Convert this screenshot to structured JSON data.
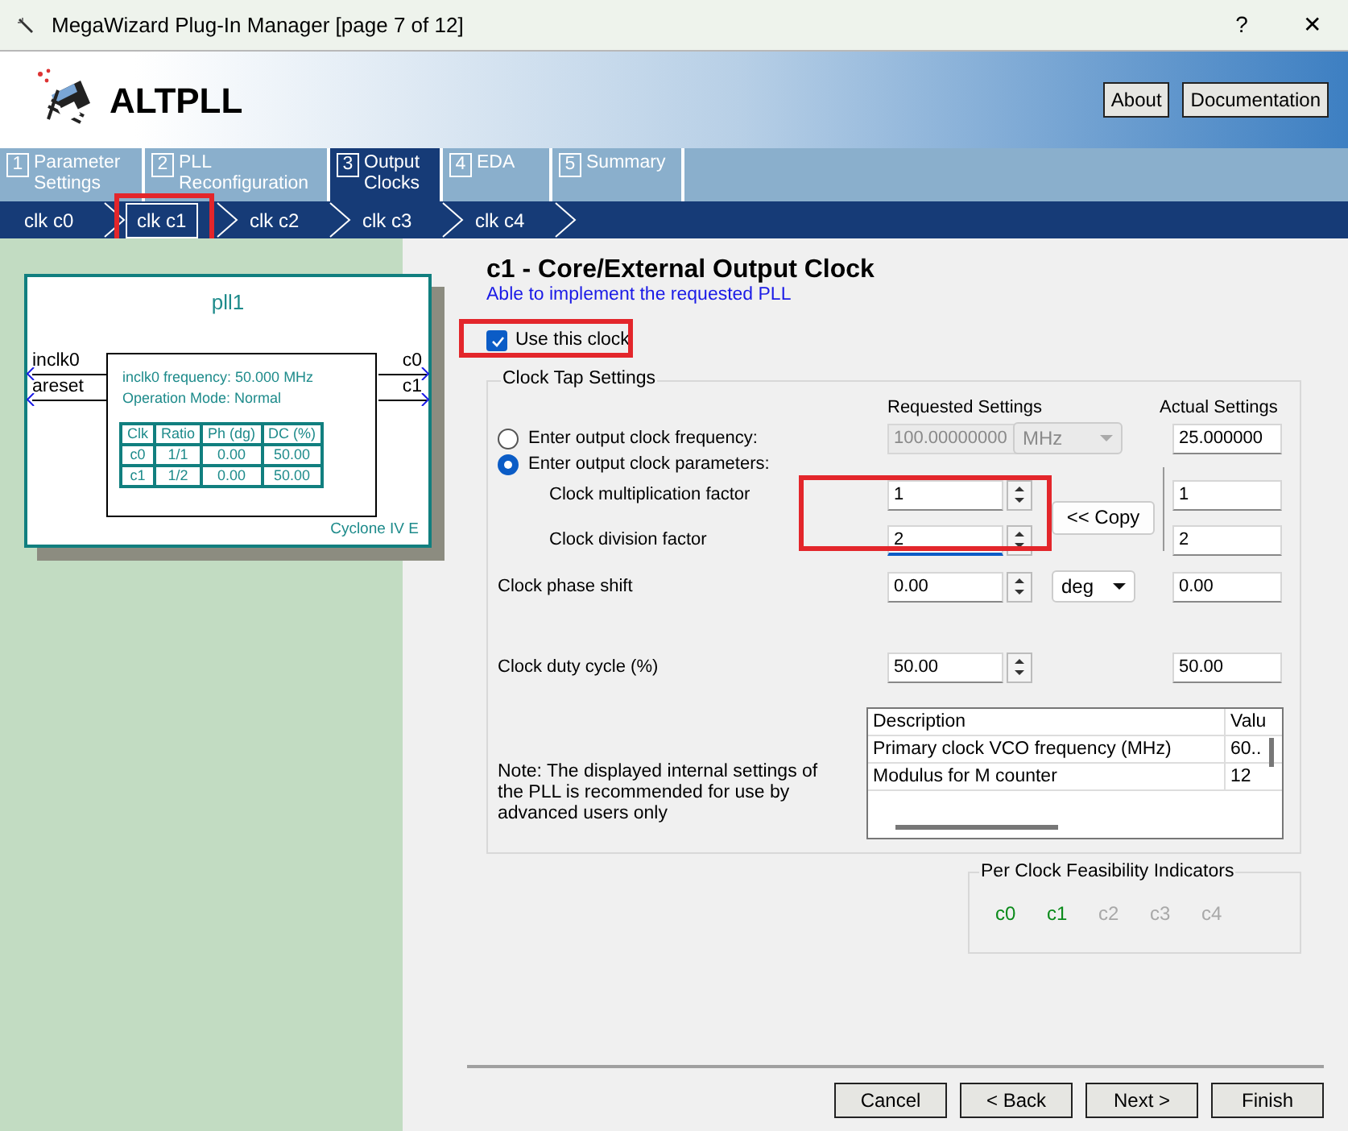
{
  "window": {
    "title": "MegaWizard Plug-In Manager [page 7 of 12]",
    "help": "?",
    "close": "✕"
  },
  "header": {
    "title": "ALTPLL",
    "buttons": [
      "About",
      "Documentation"
    ]
  },
  "steps": [
    {
      "number": "1",
      "label": "Parameter Settings",
      "selected": false
    },
    {
      "number": "2",
      "label": "PLL Reconfiguration",
      "selected": false
    },
    {
      "number": "3",
      "label": "Output Clocks",
      "selected": true
    },
    {
      "number": "4",
      "label": "EDA",
      "selected": false
    },
    {
      "number": "5",
      "label": "Summary",
      "selected": false
    }
  ],
  "clocks": [
    {
      "label": "clk c0",
      "selected": false,
      "highlighted": false
    },
    {
      "label": "clk c1",
      "selected": true,
      "highlighted": true
    },
    {
      "label": "clk c2",
      "selected": false,
      "highlighted": false
    },
    {
      "label": "clk c3",
      "selected": false,
      "highlighted": false
    },
    {
      "label": "clk c4",
      "selected": false,
      "highlighted": false
    }
  ],
  "diagram": {
    "name": "pll1",
    "inputs": [
      "inclk0",
      "areset"
    ],
    "outputs": [
      "c0",
      "c1"
    ],
    "info": [
      "inclk0 frequency: 50.000 MHz",
      "Operation Mode: Normal"
    ],
    "table": {
      "columns": [
        "Clk",
        "Ratio",
        "Ph (dg)",
        "DC (%)"
      ],
      "rows": [
        [
          "c0",
          "1/1",
          "0.00",
          "50.00"
        ],
        [
          "c1",
          "1/2",
          "0.00",
          "50.00"
        ]
      ]
    },
    "device": "Cyclone IV E"
  },
  "panel": {
    "title": "c1 - Core/External Output Clock",
    "status": "Able to implement the requested PLL",
    "use_clock": {
      "label": "Use this clock",
      "checked": true,
      "highlighted": true
    },
    "group_title": "Clock Tap Settings",
    "columns": [
      "Requested Settings",
      "Actual Settings"
    ],
    "modes": [
      {
        "label": "Enter output clock frequency:",
        "selected": false
      },
      {
        "label": "Enter output clock parameters:",
        "selected": true
      }
    ],
    "frequency": {
      "requested": "100.00000000",
      "unit": "MHz",
      "disabled": true,
      "actual": "25.000000"
    },
    "factors": [
      {
        "label": "Clock multiplication factor",
        "requested": "1",
        "actual": "1",
        "focused": false
      },
      {
        "label": "Clock division factor",
        "requested": "2",
        "actual": "2",
        "focused": true
      }
    ],
    "factors_highlighted": true,
    "copy_button": "<< Copy",
    "phase": {
      "label": "Clock phase shift",
      "requested": "0.00",
      "unit": "deg",
      "actual": "0.00"
    },
    "duty": {
      "label": "Clock duty cycle (%)",
      "requested": "50.00",
      "actual": "50.00"
    },
    "note": "Note: The displayed internal settings of the PLL is recommended for use by advanced users only",
    "internal": {
      "columns": [
        "Description",
        "Valu"
      ],
      "rows": [
        [
          "Primary clock VCO frequency (MHz)",
          "60.."
        ],
        [
          "Modulus for M counter",
          "12"
        ]
      ]
    },
    "feasibility": {
      "title": "Per Clock Feasibility Indicators",
      "items": [
        {
          "label": "c0",
          "feasible": true
        },
        {
          "label": "c1",
          "feasible": true
        },
        {
          "label": "c2",
          "feasible": false
        },
        {
          "label": "c3",
          "feasible": false
        },
        {
          "label": "c4",
          "feasible": false
        }
      ]
    }
  },
  "footer": {
    "buttons": [
      "Cancel",
      "< Back",
      "Next >",
      "Finish"
    ]
  }
}
